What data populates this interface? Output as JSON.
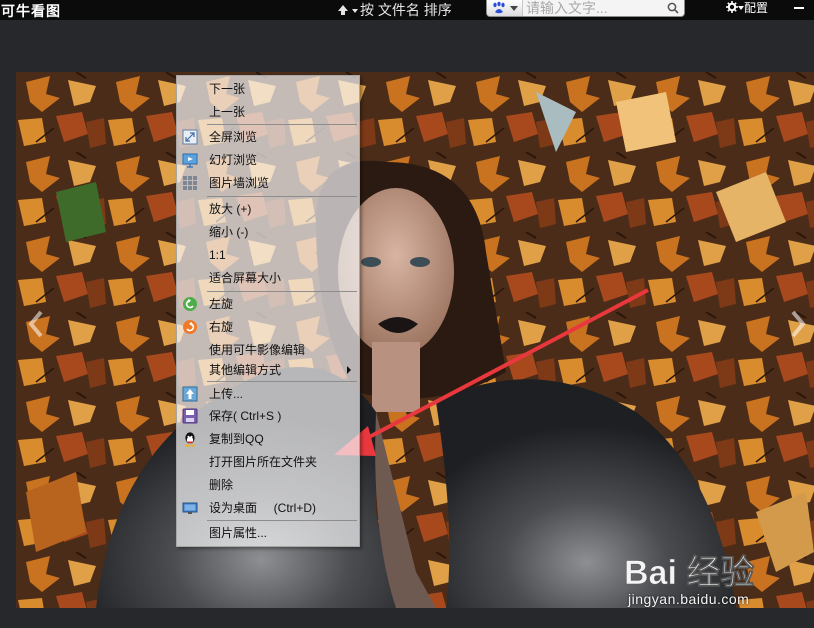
{
  "app": {
    "title": "可牛看图"
  },
  "toolbar": {
    "sort_label": "按 文件名 排序",
    "search": {
      "placeholder": "请输入文字..."
    },
    "config_label": "配置"
  },
  "menu": {
    "items": [
      {
        "label": "下一张",
        "icon": "none"
      },
      {
        "label": "上一张",
        "icon": "none"
      },
      {
        "label": "全屏浏览",
        "icon": "fullscreen-icon"
      },
      {
        "label": "幻灯浏览",
        "icon": "slideshow-icon"
      },
      {
        "label": "图片墙浏览",
        "icon": "grid-icon"
      },
      {
        "label": "放大 (+)",
        "icon": "none"
      },
      {
        "label": "缩小 (-)",
        "icon": "none"
      },
      {
        "label": "1:1",
        "icon": "none"
      },
      {
        "label": "适合屏幕大小",
        "icon": "none"
      },
      {
        "label": "左旋",
        "icon": "rotate-left-icon"
      },
      {
        "label": "右旋",
        "icon": "rotate-right-icon"
      },
      {
        "label": "使用可牛影像编辑",
        "icon": "none"
      },
      {
        "label": "其他编辑方式",
        "icon": "none",
        "submenu": true
      },
      {
        "label": "上传...",
        "icon": "upload-icon"
      },
      {
        "label": "保存( Ctrl+S )",
        "icon": "save-icon"
      },
      {
        "label": "复制到QQ",
        "icon": "qq-icon"
      },
      {
        "label": "打开图片所在文件夹",
        "icon": "none"
      },
      {
        "label": "删除",
        "icon": "none"
      },
      {
        "label": "设为桌面     (Ctrl+D)",
        "icon": "desktop-icon"
      },
      {
        "label": "图片属性...",
        "icon": "none"
      }
    ]
  },
  "watermark": {
    "brand": "Bai 经验",
    "url": "jingyan.baidu.com"
  },
  "colors": {
    "menu_bg": "#f8f8f9",
    "arrow": "#e8383d",
    "topbar": "#0b0b0c",
    "leaf_orange": "#c9721f"
  }
}
